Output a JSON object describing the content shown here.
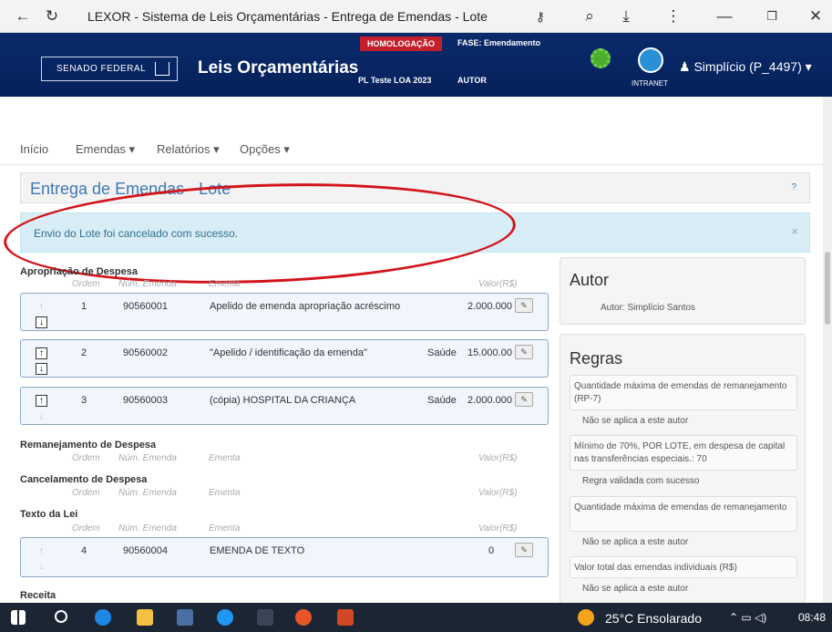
{
  "window": {
    "title": "LEXOR - Sistema de Leis Orçamentárias - Entrega de Emendas - Lote"
  },
  "header": {
    "senado": "SENADO FEDERAL",
    "app_title": "Leis Orçamentárias",
    "badge": "HOMOLOGAÇÃO",
    "fase": "FASE: Emendamento",
    "pl": "PL Teste LOA 2023",
    "autor": "AUTOR",
    "intranet": "INTRANET",
    "user": "Simplício (P_4497) ▾"
  },
  "nav": {
    "inicio": "Início",
    "emendas": "Emendas ▾",
    "relatorios": "Relatórios ▾",
    "opcoes": "Opções ▾"
  },
  "page": {
    "title": "Entrega de Emendas - Lote",
    "help": "?",
    "alert": "Envio do Lote foi cancelado com sucesso."
  },
  "columns": {
    "ordem": "Ordem",
    "numero": "Núm. Emenda",
    "ementa": "Ementa",
    "valor": "Valor(R$)"
  },
  "sections": {
    "apropriacao": "Apropriação de Despesa",
    "remanejamento": "Remanejamento de Despesa",
    "cancelamento": "Cancelamento de Despesa",
    "texto": "Texto da Lei",
    "receita": "Receita"
  },
  "rows": [
    {
      "ordem": "1",
      "numero": "90560001",
      "ementa": "Apelido de emenda apropriação acréscimo",
      "area": "",
      "valor": "2.000.000"
    },
    {
      "ordem": "2",
      "numero": "90560002",
      "ementa": "\"Apelido / identificação da emenda\"",
      "area": "Saúde",
      "valor": "15.000.00"
    },
    {
      "ordem": "3",
      "numero": "90560003",
      "ementa": "(cópia) HOSPITAL DA CRIANÇA",
      "area": "Saúde",
      "valor": "2.000.000"
    },
    {
      "ordem": "4",
      "numero": "90560004",
      "ementa": "EMENDA DE TEXTO",
      "area": "",
      "valor": "0"
    }
  ],
  "autor_panel": {
    "title": "Autor",
    "text": "Autor: Simplício Santos"
  },
  "regras_panel": {
    "title": "Regras",
    "rules": [
      {
        "text": "Quantidade máxima de emendas de remanejamento (RP-7)",
        "result": "Não se aplica a este autor"
      },
      {
        "text": "Mínimo de 70%, POR LOTE, em despesa de capital nas transferências especiais.: 70",
        "result": "Regra validada com sucesso"
      },
      {
        "text": "Quantidade máxima de emendas de remanejamento",
        "result": "Não se aplica a este autor"
      },
      {
        "text": "Valor total das emendas individuais (R$)",
        "result": "Não se aplica a este autor"
      }
    ]
  },
  "taskbar": {
    "weather": "25°C  Ensolarado",
    "time": "08:48"
  }
}
